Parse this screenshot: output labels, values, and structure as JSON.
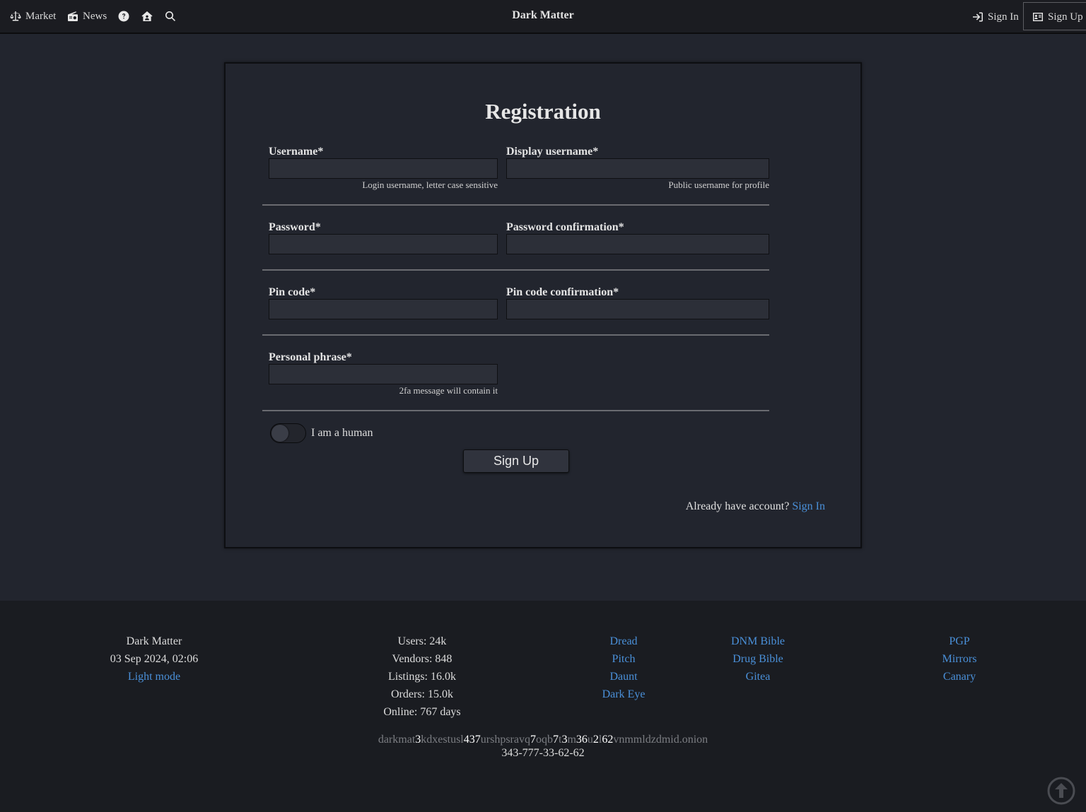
{
  "nav": {
    "left_items": [
      {
        "label": "Market",
        "icon": "scale-icon"
      },
      {
        "label": "News",
        "icon": "radio-icon"
      },
      {
        "label": "",
        "icon": "help-icon"
      },
      {
        "label": "",
        "icon": "home-icon"
      },
      {
        "label": "",
        "icon": "search-icon"
      }
    ],
    "title": "Dark Matter",
    "sign_in": "Sign In",
    "sign_up": "Sign Up"
  },
  "form": {
    "title": "Registration",
    "username": {
      "label": "Username*",
      "value": "",
      "hint": "Login username, letter case sensitive"
    },
    "display_username": {
      "label": "Display username*",
      "value": "",
      "hint": "Public username for profile"
    },
    "password": {
      "label": "Password*",
      "value": ""
    },
    "password_confirmation": {
      "label": "Password confirmation*",
      "value": ""
    },
    "pin_code": {
      "label": "Pin code*",
      "value": ""
    },
    "pin_code_confirmation": {
      "label": "Pin code confirmation*",
      "value": ""
    },
    "personal_phrase": {
      "label": "Personal phrase*",
      "value": "",
      "hint": "2fa message will contain it"
    },
    "human_toggle": {
      "label": "I am a human",
      "checked": false
    },
    "submit_label": "Sign Up",
    "already_text": "Already have account?",
    "sign_in_link": "Sign In"
  },
  "footer": {
    "site_name": "Dark Matter",
    "datetime": "03 Sep 2024, 02:06",
    "light_mode": "Light mode",
    "stats": [
      "Users: 24k",
      "Vendors: 848",
      "Listings: 16.0k",
      "Orders: 15.0k",
      "Online: 767 days"
    ],
    "links_col1": [
      "Dread",
      "Pitch",
      "Daunt",
      "Dark Eye"
    ],
    "links_col2": [
      "DNM Bible",
      "Drug Bible",
      "Gitea"
    ],
    "links_col3": [
      "PGP",
      "Mirrors",
      "Canary"
    ],
    "onion_address": "darkmat3kdxestusl437urshpsravq7oqb7t3m36u2l62vnmmldzdmid.onion",
    "phone_code": "343-777-33-62-62"
  },
  "colors": {
    "accent_link": "#4a90d9",
    "background": "#22252e",
    "nav_background": "#1b1c21",
    "footer_background": "#1a1c21"
  }
}
